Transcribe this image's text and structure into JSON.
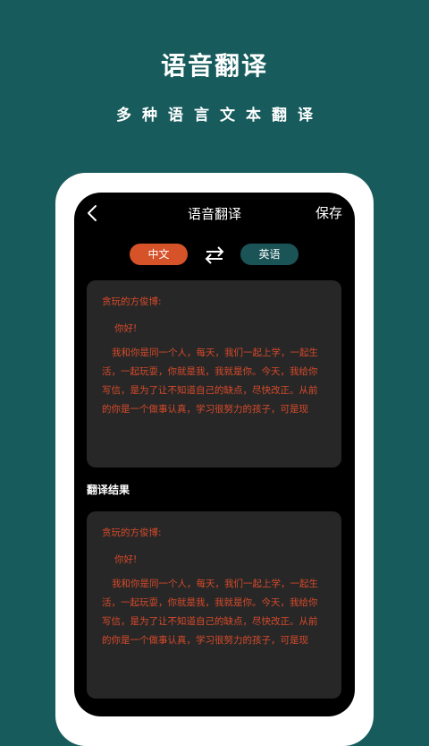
{
  "promo": {
    "title": "语音翻译",
    "subtitle": "多种语言文本翻译"
  },
  "nav": {
    "title": "语音翻译",
    "save_label": "保存"
  },
  "languages": {
    "source": "中文",
    "target": "英语"
  },
  "source_text": {
    "salutation": "贪玩的方俊博:",
    "greeting": "你好!",
    "body": "我和你是同一个人，每天，我们一起上学，一起生活，一起玩耍，你就是我，我就是你。今天，我给你写信，是为了让不知道自己的缺点，尽快改正。从前的你是一个做事认真，学习很努力的孩子，可是现"
  },
  "result": {
    "label": "翻译结果",
    "salutation": "贪玩的方俊博:",
    "greeting": "你好!",
    "body": "我和你是同一个人，每天，我们一起上学，一起生活，一起玩耍，你就是我，我就是你。今天，我给你写信，是为了让不知道自己的缺点，尽快改正。从前的你是一个做事认真，学习很努力的孩子，可是现"
  },
  "icons": {
    "back": "chevron-left-icon",
    "swap": "swap-arrows-icon"
  },
  "colors": {
    "background": "#175b5c",
    "source_pill": "#d65229",
    "target_pill": "#1b5457",
    "card_text": "#d64a2a",
    "card_bg": "#272727"
  }
}
